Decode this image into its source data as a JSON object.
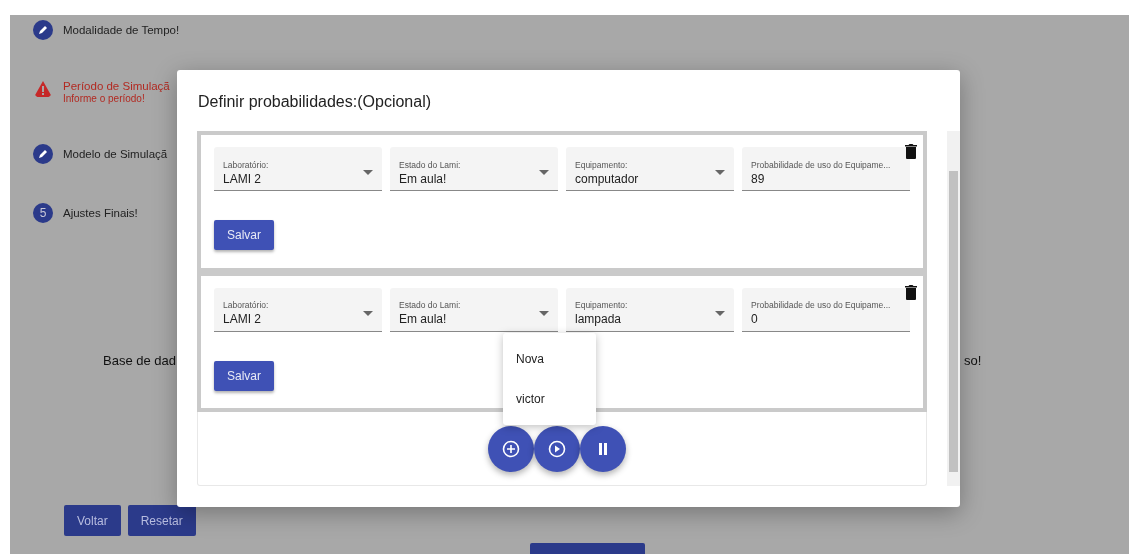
{
  "steps": [
    {
      "kind": "edit",
      "label": "Modalidade de Tempo!"
    },
    {
      "kind": "error",
      "label": "Período de Simulaçã",
      "sublabel": "Informe o período!"
    },
    {
      "kind": "edit",
      "label": "Modelo de Simulaçã"
    },
    {
      "kind": "number",
      "number": "5",
      "label": "Ajustes Finais!"
    }
  ],
  "background_text": {
    "left": "Base de dad",
    "right": "so!"
  },
  "buttons": [
    "Voltar",
    "Resetar"
  ],
  "dialog": {
    "title": "Definir probabilidades:(Opcional)",
    "rows": [
      {
        "fields": [
          {
            "kind": "select",
            "label": "Laboratório:",
            "value": "LAMI 2"
          },
          {
            "kind": "select",
            "label": "Estado do Lami:",
            "value": "Em aula!"
          },
          {
            "kind": "select",
            "label": "Equipamento:",
            "value": "computador"
          },
          {
            "kind": "input",
            "label": "Probabilidade de uso do Equipame...",
            "value": "89"
          }
        ],
        "button": "Salvar"
      },
      {
        "fields": [
          {
            "kind": "select",
            "label": "Laboratório:",
            "value": "LAMI 2"
          },
          {
            "kind": "select",
            "label": "Estado do Lami:",
            "value": "Em aula!"
          },
          {
            "kind": "select",
            "label": "Equipamento:",
            "value": "lampada"
          },
          {
            "kind": "input",
            "label": "Probabilidade de uso do Equipame...",
            "value": "0"
          }
        ],
        "button": "Salvar"
      }
    ],
    "menu": [
      "Nova",
      "victor"
    ]
  }
}
